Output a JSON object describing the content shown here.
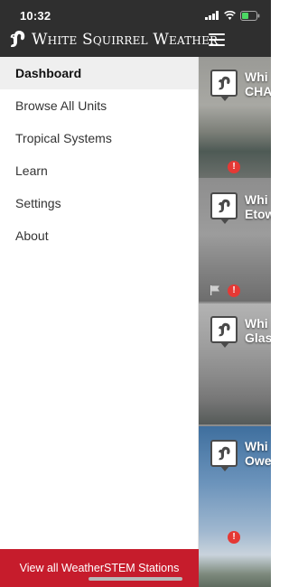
{
  "status_bar": {
    "time": "10:32"
  },
  "header": {
    "title": "White Squirrel Weather"
  },
  "drawer": {
    "items": [
      {
        "label": "Dashboard",
        "active": true
      },
      {
        "label": "Browse All Units",
        "active": false
      },
      {
        "label": "Tropical Systems",
        "active": false
      },
      {
        "label": "Learn",
        "active": false
      },
      {
        "label": "Settings",
        "active": false
      },
      {
        "label": "About",
        "active": false
      }
    ],
    "footer_label": "View all WeatherSTEM Stations"
  },
  "cards": [
    {
      "title_line1": "Whi",
      "title_line2": "CHA",
      "alert": "!",
      "flag": false
    },
    {
      "title_line1": "Whi",
      "title_line2": "Etow",
      "alert": "!",
      "flag": true
    },
    {
      "title_line1": "Whi",
      "title_line2": "Glas",
      "alert": "",
      "flag": false
    },
    {
      "title_line1": "Whi",
      "title_line2": "Owe",
      "alert": "!",
      "flag": false
    }
  ],
  "colors": {
    "header_bg": "#2f2f2f",
    "footer_bg": "#c61c2c",
    "active_item_bg": "#efefef",
    "alert": "#e53935"
  }
}
